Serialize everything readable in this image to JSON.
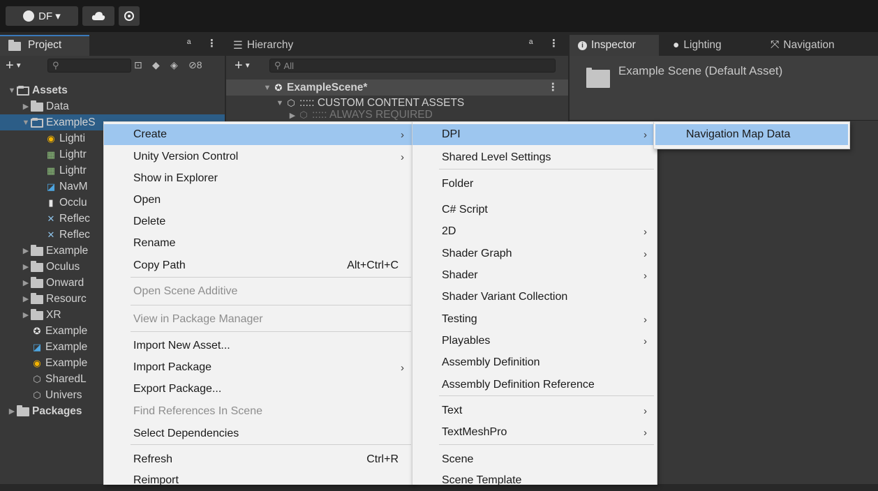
{
  "toolbar": {
    "account_label": "DF ▾"
  },
  "project_tab": {
    "label": "Project"
  },
  "hierarchy_tab": {
    "label": "Hierarchy",
    "search_placeholder": "All"
  },
  "inspector": {
    "tabs": [
      "Inspector",
      "Lighting",
      "Navigation"
    ],
    "title": "Example Scene (Default Asset)"
  },
  "hierarchy_items": [
    {
      "label": "ExampleScene*"
    },
    {
      "label": "::::: CUSTOM CONTENT ASSETS"
    },
    {
      "label": "::::: ALWAYS REQUIRED"
    }
  ],
  "project_tree": [
    {
      "label": "Assets",
      "bold": true
    },
    {
      "label": "Data"
    },
    {
      "label": "ExampleS"
    },
    {
      "label": "Lighti"
    },
    {
      "label": "Lightr"
    },
    {
      "label": "Lightr"
    },
    {
      "label": "NavM"
    },
    {
      "label": "Occlu"
    },
    {
      "label": "Reflec"
    },
    {
      "label": "Reflec"
    },
    {
      "label": "Example"
    },
    {
      "label": "Oculus"
    },
    {
      "label": "Onward"
    },
    {
      "label": "Resourc"
    },
    {
      "label": "XR"
    },
    {
      "label": "Example"
    },
    {
      "label": "Example"
    },
    {
      "label": "Example"
    },
    {
      "label": "SharedL"
    },
    {
      "label": "Univers"
    },
    {
      "label": "Packages",
      "bold": true
    }
  ],
  "context_menu": {
    "items": [
      {
        "label": "Create",
        "submenu": true,
        "highlight": true
      },
      {
        "label": "Unity Version Control",
        "submenu": true
      },
      {
        "label": "Show in Explorer"
      },
      {
        "label": "Open"
      },
      {
        "label": "Delete"
      },
      {
        "label": "Rename"
      },
      {
        "label": "Copy Path",
        "shortcut": "Alt+Ctrl+C"
      },
      {
        "label": "Open Scene Additive",
        "disabled": true
      },
      {
        "label": "View in Package Manager",
        "disabled": true
      },
      {
        "label": "Import New Asset..."
      },
      {
        "label": "Import Package",
        "submenu": true
      },
      {
        "label": "Export Package..."
      },
      {
        "label": "Find References In Scene",
        "disabled": true
      },
      {
        "label": "Select Dependencies"
      },
      {
        "label": "Refresh",
        "shortcut": "Ctrl+R"
      },
      {
        "label": "Reimport"
      }
    ]
  },
  "create_menu": {
    "items": [
      {
        "label": "DPI",
        "submenu": true,
        "highlight": true
      },
      {
        "label": "Shared Level Settings"
      },
      {
        "label": "Folder"
      },
      {
        "label": "C# Script"
      },
      {
        "label": "2D",
        "submenu": true
      },
      {
        "label": "Shader Graph",
        "submenu": true
      },
      {
        "label": "Shader",
        "submenu": true
      },
      {
        "label": "Shader Variant Collection"
      },
      {
        "label": "Testing",
        "submenu": true
      },
      {
        "label": "Playables",
        "submenu": true
      },
      {
        "label": "Assembly Definition"
      },
      {
        "label": "Assembly Definition Reference"
      },
      {
        "label": "Text",
        "submenu": true
      },
      {
        "label": "TextMeshPro",
        "submenu": true
      },
      {
        "label": "Scene"
      },
      {
        "label": "Scene Template"
      }
    ]
  },
  "dpi_menu": {
    "items": [
      {
        "label": "Navigation Map Data",
        "highlight": true
      }
    ]
  }
}
